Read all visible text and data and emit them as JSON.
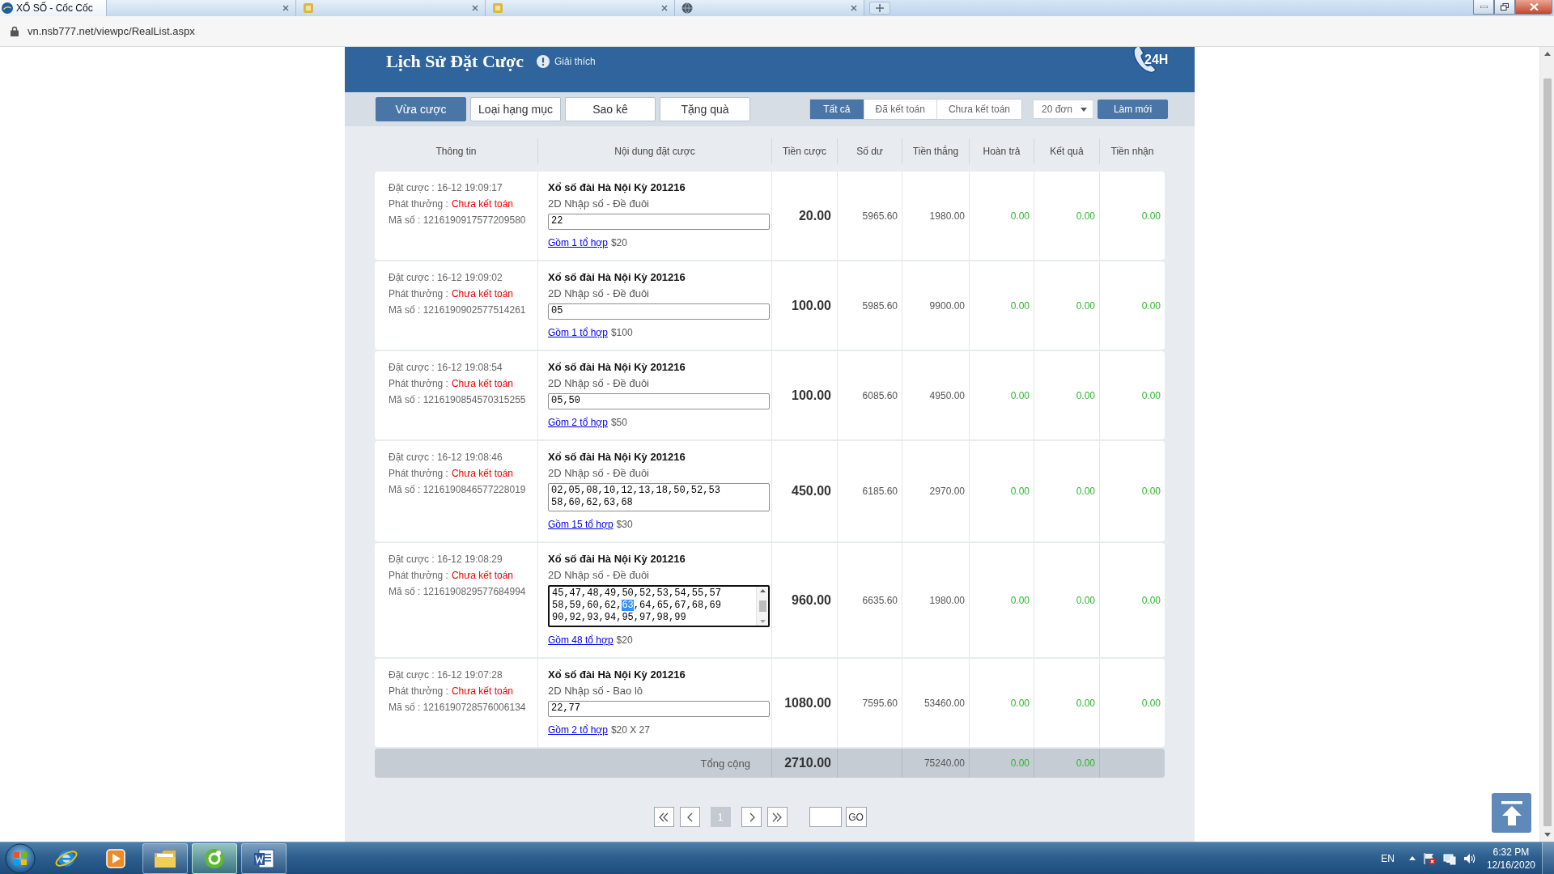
{
  "browser": {
    "tabs": [
      {
        "title": "XỔ SỐ - Cốc Cốc",
        "selected": true,
        "kind": "logo"
      },
      {
        "selected": false,
        "kind": "blank"
      },
      {
        "selected": false,
        "kind": "square"
      },
      {
        "selected": false,
        "kind": "square"
      },
      {
        "selected": false,
        "kind": "globe"
      }
    ],
    "url": "vn.nsb777.net/viewpc/RealList.aspx"
  },
  "header": {
    "title": "Lịch Sử Đặt Cược",
    "help_label": "Giải thích",
    "hotline_badge": "24H"
  },
  "tabs": [
    {
      "label": "Vừa cược",
      "selected": true
    },
    {
      "label": "Loại hạng mục",
      "selected": false
    },
    {
      "label": "Sao kê",
      "selected": false
    },
    {
      "label": "Tặng quà",
      "selected": false
    }
  ],
  "filters": [
    {
      "label": "Tất cả",
      "selected": true
    },
    {
      "label": "Đã kết toán",
      "selected": false
    },
    {
      "label": "Chưa kết toán",
      "selected": false
    }
  ],
  "page_size": {
    "value": "20 đơn"
  },
  "refresh_button": "Làm mới",
  "table": {
    "columns": [
      "Thông tin",
      "Nội dung đặt cược",
      "Tiền cược",
      "Số dư",
      "Tiền thắng",
      "Hoàn trả",
      "Kết quả",
      "Tiền nhận"
    ],
    "rows": [
      {
        "placed_at": "Đặt cược : 16-12 19:09:17",
        "payout_label": "Phát thưởng :",
        "payout_status": "Chưa kết toán",
        "code": "Mã số : 1216190917577209580",
        "game": "Xổ số đài Hà Nội Kỳ 201216",
        "bet_type": "2D Nhập số - Đề đuôi",
        "numbers": [
          {
            "text": "22",
            "selected": false
          }
        ],
        "focused": false,
        "scrollable": false,
        "combinations": "Gồm 1 tổ hợp",
        "unit_price": "$20",
        "stake": "20.00",
        "balance": "5965.60",
        "winnings": "1980.00",
        "refund": "0.00",
        "result": "0.00",
        "received": "0.00"
      },
      {
        "placed_at": "Đặt cược : 16-12 19:09:02",
        "payout_label": "Phát thưởng :",
        "payout_status": "Chưa kết toán",
        "code": "Mã số : 1216190902577514261",
        "game": "Xổ số đài Hà Nội Kỳ 201216",
        "bet_type": "2D Nhập số - Đề đuôi",
        "numbers": [
          {
            "text": "05",
            "selected": false
          }
        ],
        "focused": false,
        "scrollable": false,
        "combinations": "Gồm 1 tổ hợp",
        "unit_price": "$100",
        "stake": "100.00",
        "balance": "5985.60",
        "winnings": "9900.00",
        "refund": "0.00",
        "result": "0.00",
        "received": "0.00"
      },
      {
        "placed_at": "Đặt cược : 16-12 19:08:54",
        "payout_label": "Phát thưởng :",
        "payout_status": "Chưa kết toán",
        "code": "Mã số : 1216190854570315255",
        "game": "Xổ số đài Hà Nội Kỳ 201216",
        "bet_type": "2D Nhập số - Đề đuôi",
        "numbers": [
          {
            "text": "05,50",
            "selected": false
          }
        ],
        "focused": false,
        "scrollable": false,
        "combinations": "Gồm 2 tổ hợp",
        "unit_price": "$50",
        "stake": "100.00",
        "balance": "6085.60",
        "winnings": "4950.00",
        "refund": "0.00",
        "result": "0.00",
        "received": "0.00"
      },
      {
        "placed_at": "Đặt cược : 16-12 19:08:46",
        "payout_label": "Phát thưởng :",
        "payout_status": "Chưa kết toán",
        "code": "Mã số : 1216190846577228019",
        "game": "Xổ số đài Hà Nội Kỳ 201216",
        "bet_type": "2D Nhập số - Đề đuôi",
        "numbers": [
          {
            "text": "02,05,08,10,12,13,18,50,52,53\n58,60,62,63,68",
            "selected": false
          }
        ],
        "focused": false,
        "scrollable": false,
        "combinations": "Gồm 15 tổ hợp",
        "unit_price": "$30",
        "stake": "450.00",
        "balance": "6185.60",
        "winnings": "2970.00",
        "refund": "0.00",
        "result": "0.00",
        "received": "0.00"
      },
      {
        "placed_at": "Đặt cược : 16-12 19:08:29",
        "payout_label": "Phát thưởng :",
        "payout_status": "Chưa kết toán",
        "code": "Mã số : 1216190829577684994",
        "game": "Xổ số đài Hà Nội Kỳ 201216",
        "bet_type": "2D Nhập số - Đề đuôi",
        "numbers": [
          {
            "text": "45,47,48,49,50,52,53,54,55,57\n58,59,60,62,",
            "selected": false
          },
          {
            "text": "63",
            "selected": true
          },
          {
            "text": ",64,65,67,68,69\n90,92,93,94,95,97,98,99",
            "selected": false
          }
        ],
        "focused": true,
        "scrollable": true,
        "combinations": "Gồm 48 tổ hợp",
        "unit_price": "$20",
        "stake": "960.00",
        "balance": "6635.60",
        "winnings": "1980.00",
        "refund": "0.00",
        "result": "0.00",
        "received": "0.00"
      },
      {
        "placed_at": "Đặt cược : 16-12 19:07:28",
        "payout_label": "Phát thưởng :",
        "payout_status": "Chưa kết toán",
        "code": "Mã số : 1216190728576006134",
        "game": "Xổ số đài Hà Nội Kỳ 201216",
        "bet_type": "2D Nhập số - Bao lô",
        "numbers": [
          {
            "text": "22,77",
            "selected": false
          }
        ],
        "focused": false,
        "scrollable": false,
        "combinations": "Gồm 2 tổ hợp",
        "unit_price": "$20 X 27",
        "stake": "1080.00",
        "balance": "7595.60",
        "winnings": "53460.00",
        "refund": "0.00",
        "result": "0.00",
        "received": "0.00"
      }
    ],
    "total": {
      "label": "Tổng cộng",
      "stake": "2710.00",
      "winnings": "75240.00",
      "refund": "0.00",
      "result": "0.00"
    }
  },
  "pagination": {
    "pages": [
      {
        "label": "1",
        "selected": true
      }
    ],
    "go_button": "GO"
  },
  "taskbar": {
    "apps": [
      {
        "kind": "ie",
        "running": false,
        "selected": false
      },
      {
        "kind": "media",
        "running": false,
        "selected": false
      },
      {
        "kind": "explorer",
        "running": true,
        "selected": false
      },
      {
        "kind": "coccoc",
        "running": true,
        "selected": true
      },
      {
        "kind": "word",
        "running": true,
        "selected": false
      }
    ],
    "language": "EN",
    "time": "6:32 PM",
    "date": "12/16/2020"
  }
}
